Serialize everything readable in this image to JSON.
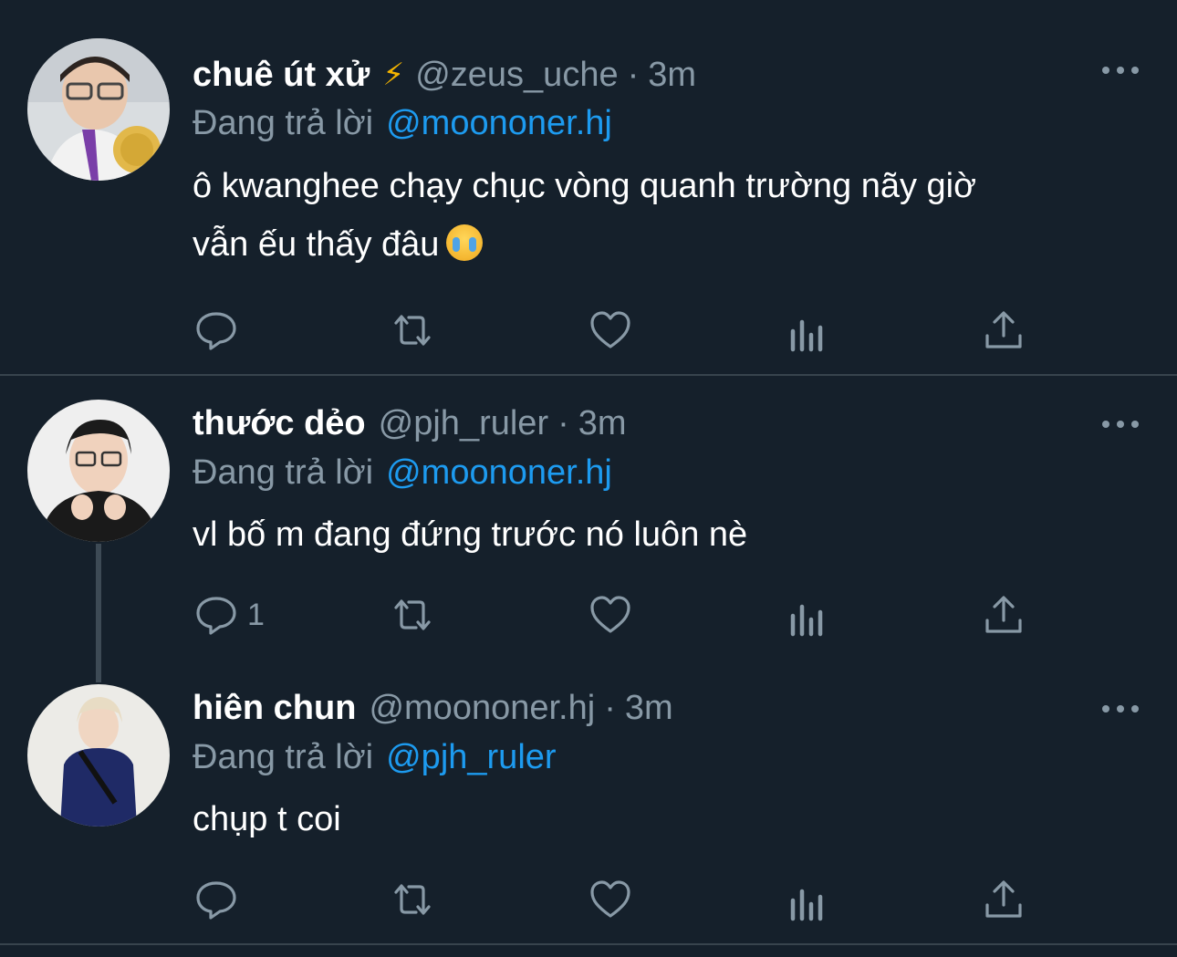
{
  "tweets": [
    {
      "display_name": "chuê út xử",
      "badge": "⚡",
      "handle": "@zeus_uche",
      "separator": "·",
      "time": "3m",
      "reply_label": "Đang trả lời",
      "reply_to": "@moononer.hj",
      "text_line1": "ô kwanghee chạy chục vòng quanh trường nãy giờ",
      "text_line2": "vẫn ếu thấy đâu",
      "emoji": "loudly-crying-face",
      "reply_count": ""
    },
    {
      "display_name": "thước dẻo",
      "handle": "@pjh_ruler",
      "separator": "·",
      "time": "3m",
      "reply_label": "Đang trả lời",
      "reply_to": "@moononer.hj",
      "text": "vl bố m đang đứng trước nó luôn nè",
      "reply_count": "1"
    },
    {
      "display_name": "hiên chun",
      "handle": "@moononer.hj",
      "separator": "·",
      "time": "3m",
      "reply_label": "Đang trả lời",
      "reply_to": "@pjh_ruler",
      "text": "chụp t coi",
      "reply_count": ""
    }
  ],
  "icons": {
    "more": "more-horizontal-icon",
    "reply": "reply-bubble-icon",
    "retweet": "retweet-icon",
    "like": "heart-icon",
    "views": "analytics-icon",
    "share": "share-icon"
  },
  "colors": {
    "background": "#15202b",
    "text": "#ffffff",
    "muted": "#8899a6",
    "link": "#1d9bf0",
    "divider": "#38444d"
  }
}
